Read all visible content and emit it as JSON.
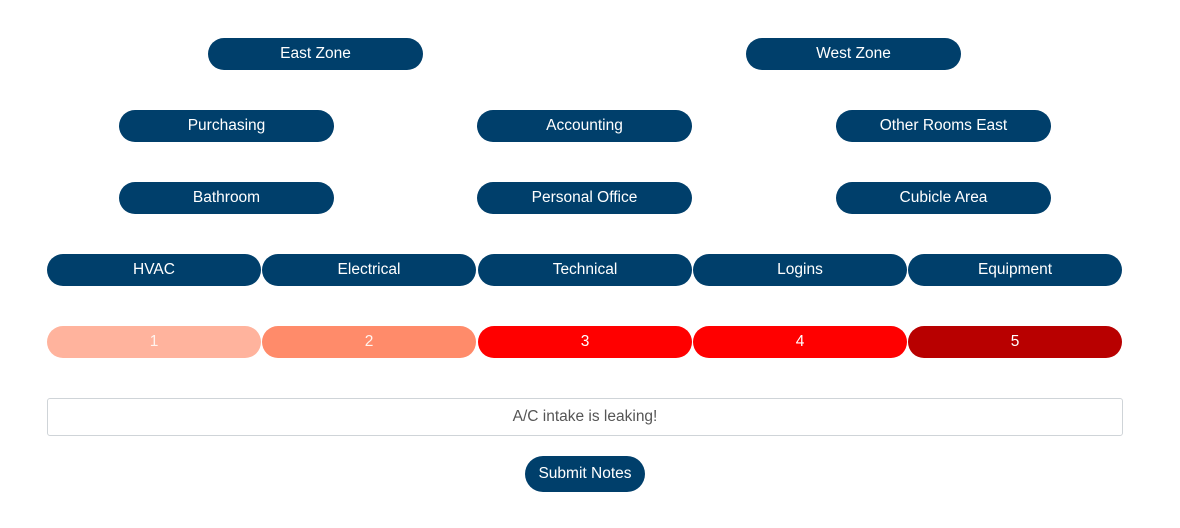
{
  "zones": {
    "east": "East Zone",
    "west": "West Zone"
  },
  "rooms": {
    "purchasing": "Purchasing",
    "accounting": "Accounting",
    "other_rooms_east": "Other Rooms East",
    "bathroom": "Bathroom",
    "personal_office": "Personal Office",
    "cubicle_area": "Cubicle Area"
  },
  "categories": [
    "HVAC",
    "Electrical",
    "Technical",
    "Logins",
    "Equipment"
  ],
  "severity": {
    "levels": [
      "1",
      "2",
      "3",
      "4",
      "5"
    ],
    "colors": [
      "#ffb39d",
      "#ff8b6a",
      "#ff0000",
      "#ff0000",
      "#b80000"
    ]
  },
  "notes": {
    "value": "A/C intake is leaking!"
  },
  "submit_label": "Submit Notes",
  "theme": {
    "primary": "#003f6b"
  }
}
